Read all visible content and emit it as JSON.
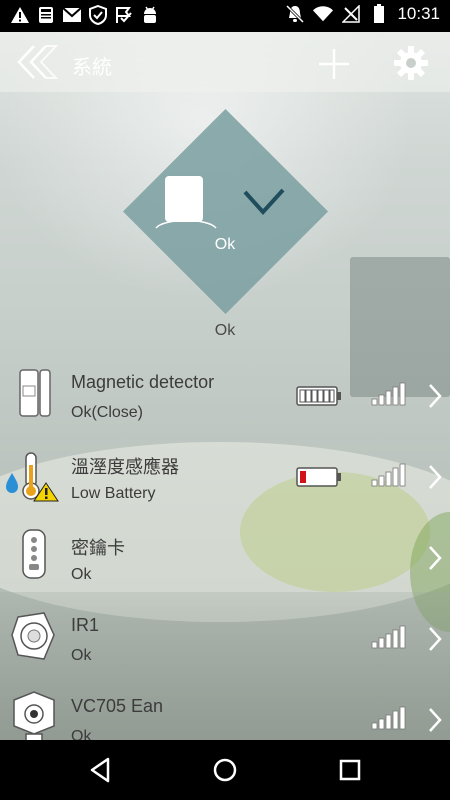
{
  "statusbar": {
    "time": "10:31",
    "left_icons": [
      "warning-icon",
      "sd-card-icon",
      "gmail-icon",
      "shield-icon",
      "check-flag-icon",
      "android-debug-icon"
    ],
    "right_icons": [
      "bell-off-icon",
      "wifi-icon",
      "no-signal-icon",
      "battery-icon"
    ]
  },
  "appbar": {
    "title": "系統",
    "back_icon": "double-chevron-left-icon",
    "add_icon": "plus-icon",
    "settings_icon": "gear-icon"
  },
  "hero": {
    "diamond_label": "Ok",
    "state_label": "Ok",
    "accent": "#7a9fa1",
    "check_color": "#1f4d5c"
  },
  "devices": [
    {
      "name": "Magnetic detector",
      "status": "Ok(Close)",
      "icon": "magnetic-detector-icon",
      "battery": "full",
      "signal": true
    },
    {
      "name": "溫溼度感應器",
      "status": "Low Battery",
      "icon": "thermometer-icon",
      "battery": "low",
      "signal": true
    },
    {
      "name": "密鑰卡",
      "status": "Ok",
      "icon": "key-fob-icon",
      "battery": null,
      "signal": false
    },
    {
      "name": "IR1",
      "status": "Ok",
      "icon": "ir-sensor-icon",
      "battery": null,
      "signal": true
    },
    {
      "name": "VC705 Ean",
      "status": "Ok",
      "icon": "camera-icon",
      "battery": null,
      "signal": true
    }
  ],
  "navbar": {
    "back_icon": "nav-back-icon",
    "home_icon": "nav-home-icon",
    "recents_icon": "nav-recents-icon"
  }
}
